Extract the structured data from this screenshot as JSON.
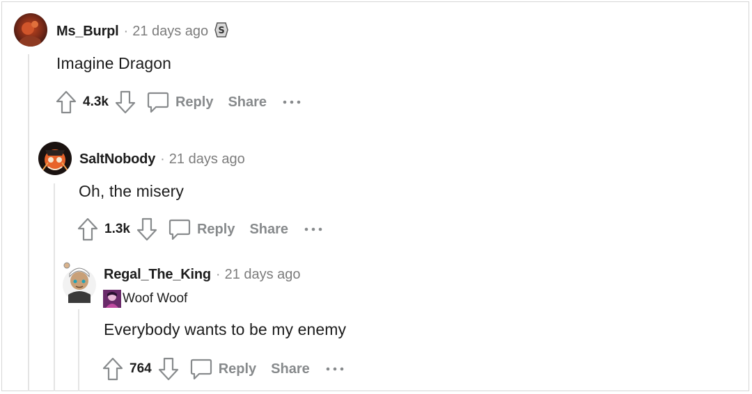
{
  "comments": [
    {
      "username": "Ms_Burpl",
      "time": "21 days ago",
      "body": "Imagine Dragon",
      "score": "4.3k",
      "reply_label": "Reply",
      "share_label": "Share",
      "has_badge": true
    },
    {
      "username": "SaltNobody",
      "time": "21 days ago",
      "body": "Oh, the misery",
      "score": "1.3k",
      "reply_label": "Reply",
      "share_label": "Share"
    },
    {
      "username": "Regal_The_King",
      "time": "21 days ago",
      "flair": "Woof Woof",
      "body": "Everybody wants to be my enemy",
      "score": "764",
      "reply_label": "Reply",
      "share_label": "Share"
    }
  ],
  "separator": "·",
  "colors": {
    "muted_text": "#878a8c",
    "thread_line": "#e4e4e4",
    "text": "#1c1c1c"
  },
  "icons": [
    "upvote-icon",
    "downvote-icon",
    "reply-icon",
    "more-options-icon",
    "badge-icon"
  ]
}
